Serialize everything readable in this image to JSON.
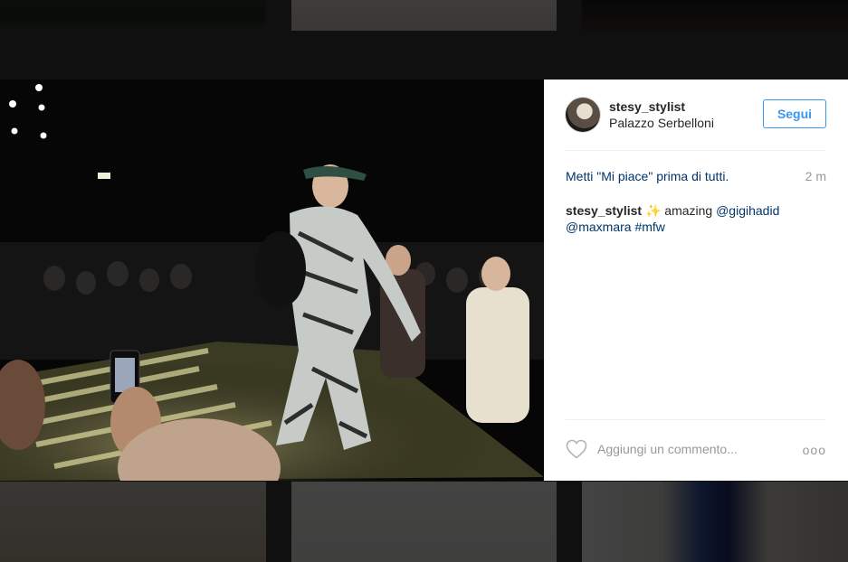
{
  "post": {
    "username": "stesy_stylist",
    "location": "Palazzo Serbelloni",
    "follow_label": "Segui",
    "likes_text_before": "Metti ",
    "likes_link": "\"Mi piace\" prima di tutti.",
    "time": "2 m",
    "caption": {
      "username": "stesy_stylist",
      "sparkle": "✨",
      "text": " amazing ",
      "mention1": "@gigihadid",
      "mention2": "@maxmara",
      "hashtag": "#mfw"
    },
    "comment_placeholder": "Aggiungi un commento...",
    "more_label": "ooo"
  },
  "colors": {
    "accent": "#3897f0",
    "link": "#003569",
    "muted": "#999999"
  },
  "icons": [
    "heart-icon",
    "more-options-icon"
  ]
}
